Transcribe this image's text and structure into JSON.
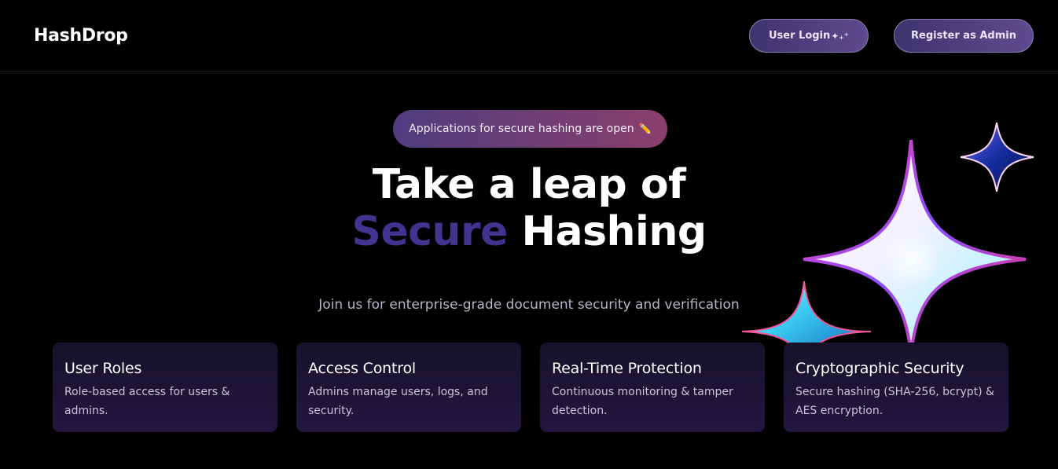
{
  "header": {
    "logo": "HashDrop",
    "login_label": "User Login",
    "login_sparkle": "✦₊⁺",
    "register_label": "Register as Admin"
  },
  "hero": {
    "pill_text": "Applications for secure hashing are open",
    "pill_icon": "✏️",
    "title_line1": "Take a leap of",
    "title_accent": "Secure",
    "title_rest": " Hashing",
    "subtitle": "Join us for enterprise-grade document security and verification",
    "accent_color": "#43338f"
  },
  "features": [
    {
      "title": "User Roles",
      "description": "Role-based access for users & admins."
    },
    {
      "title": "Access Control",
      "description": "Admins manage users, logs, and security."
    },
    {
      "title": "Real-Time Protection",
      "description": "Continuous monitoring & tamper detection."
    },
    {
      "title": "Cryptographic Security",
      "description": "Secure hashing (SHA-256, bcrypt) & AES encryption."
    }
  ]
}
